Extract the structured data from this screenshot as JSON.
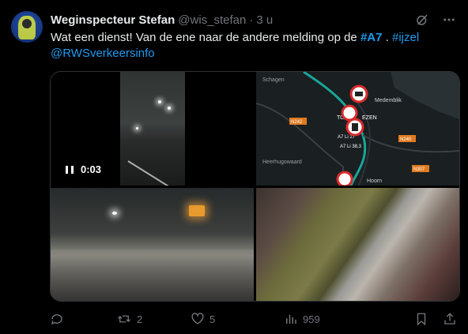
{
  "tweet": {
    "author_name": "Weginspecteur Stefan",
    "author_handle": "@wis_stefan",
    "separator": "·",
    "time": "3 u",
    "text_prefix": "Wat een dienst! Van de ene naar de andere melding op de ",
    "hashtag1": "#A7",
    "text_mid": " . ",
    "hashtag2": "#ijzel",
    "mention": "@RWSverkeersinfo"
  },
  "media": {
    "video_duration": "0:03",
    "map_labels": {
      "place1": "Schagen",
      "place2": "Medemblik",
      "place3": "Heerhugowaard",
      "place4": "Hoorn",
      "place5": "TO",
      "place6": "EZEN",
      "road1": "N242",
      "road2": "N240",
      "road3": "N307",
      "incident1": "A7 Li 27",
      "incident2": "A7 Li 38,3"
    }
  },
  "actions": {
    "reply_count": "",
    "retweet_count": "2",
    "like_count": "5",
    "views_count": "959"
  },
  "colors": {
    "link": "#1d9bf0",
    "muted": "#71767b",
    "text": "#e7e9ea"
  },
  "icons": [
    "grok-icon",
    "more-icon",
    "reply-icon",
    "retweet-icon",
    "like-icon",
    "views-icon",
    "bookmark-icon",
    "share-icon",
    "pause-icon"
  ]
}
